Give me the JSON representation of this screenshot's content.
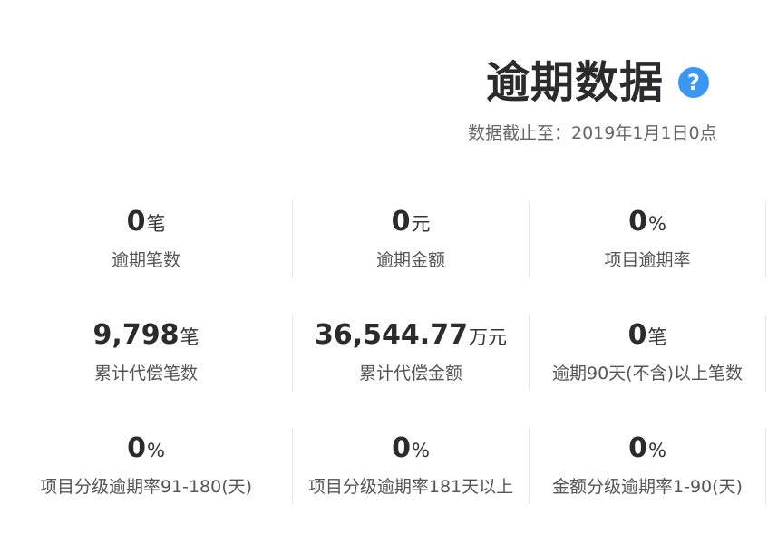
{
  "header": {
    "title": "逾期数据",
    "help_icon": "question-circle-icon",
    "help_glyph": "?",
    "subtitle": "数据截止至：2019年1月1日0点",
    "accent_color": "#3b97f4"
  },
  "stats": [
    [
      {
        "value": "0",
        "unit": "笔",
        "label": "逾期笔数"
      },
      {
        "value": "0",
        "unit": "元",
        "label": "逾期金额"
      },
      {
        "value": "0",
        "unit": "%",
        "label": "项目逾期率"
      }
    ],
    [
      {
        "value": "9,798",
        "unit": "笔",
        "label": "累计代偿笔数"
      },
      {
        "value": "36,544.77",
        "unit": "万元",
        "label": "累计代偿金额"
      },
      {
        "value": "0",
        "unit": "笔",
        "label": "逾期90天(不含)以上笔数"
      }
    ],
    [
      {
        "value": "0",
        "unit": "%",
        "label": "项目分级逾期率91-180(天)"
      },
      {
        "value": "0",
        "unit": "%",
        "label": "项目分级逾期率181天以上"
      },
      {
        "value": "0",
        "unit": "%",
        "label": "金额分级逾期率1-90(天)"
      }
    ]
  ]
}
